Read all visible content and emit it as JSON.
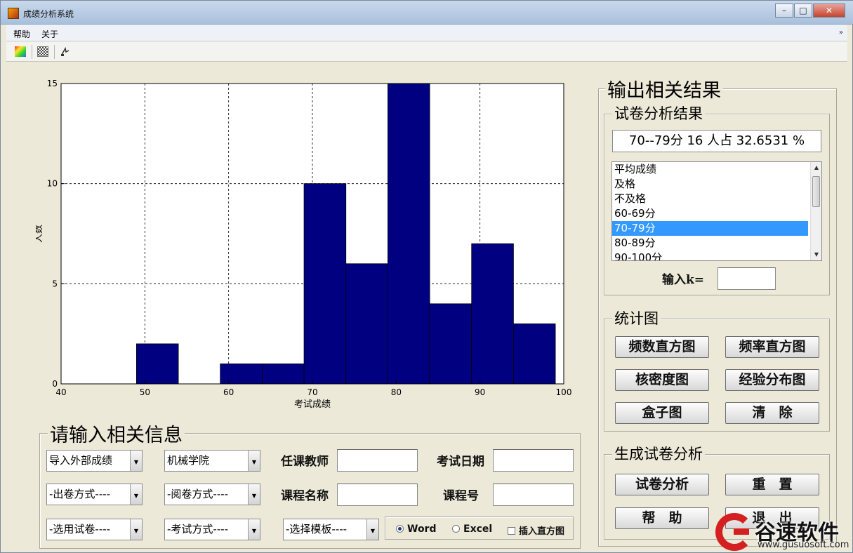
{
  "window": {
    "title": "成绩分析系统",
    "controls": {
      "minimize": "–",
      "maximize": "□",
      "close": "✕"
    }
  },
  "menu": {
    "items": [
      "帮助",
      "关于"
    ],
    "overflow": "»"
  },
  "toolbar": {
    "icons": [
      "colormap-icon",
      "grid-pattern-icon",
      "data-cursor-icon"
    ]
  },
  "chart_data": {
    "type": "bar",
    "title": "",
    "xlabel": "考试成绩",
    "ylabel": "人数",
    "xlim": [
      40,
      100
    ],
    "ylim": [
      0,
      15
    ],
    "xticks": [
      40,
      50,
      60,
      70,
      80,
      90,
      100
    ],
    "yticks": [
      0,
      5,
      10,
      15
    ],
    "grid": true,
    "bar_color": "#000080",
    "bins": [
      {
        "x0": 49,
        "x1": 54,
        "value": 2
      },
      {
        "x0": 54,
        "x1": 59,
        "value": 0
      },
      {
        "x0": 59,
        "x1": 64,
        "value": 1
      },
      {
        "x0": 64,
        "x1": 69,
        "value": 1
      },
      {
        "x0": 69,
        "x1": 74,
        "value": 10
      },
      {
        "x0": 74,
        "x1": 79,
        "value": 6
      },
      {
        "x0": 79,
        "x1": 84,
        "value": 15
      },
      {
        "x0": 84,
        "x1": 89,
        "value": 4
      },
      {
        "x0": 89,
        "x1": 94,
        "value": 7
      },
      {
        "x0": 94,
        "x1": 99,
        "value": 3
      }
    ]
  },
  "output_panel": {
    "title": "输出相关结果",
    "analysis": {
      "title": "试卷分析结果",
      "result_text": "70--79分 16 人占 32.6531 %",
      "list": [
        "平均成绩",
        "及格",
        "不及格",
        "60-69分",
        "70-79分",
        "80-89分",
        "90-100分"
      ],
      "selected_index": 4,
      "k_label": "输入k=",
      "k_value": ""
    },
    "stats": {
      "title": "统计图",
      "buttons": [
        "频数直方图",
        "频率直方图",
        "核密度图",
        "经验分布图",
        "盒子图",
        "清　除"
      ]
    },
    "generate": {
      "title": "生成试卷分析",
      "buttons": [
        "试卷分析",
        "重　置",
        "帮　助",
        "退　出"
      ]
    }
  },
  "input_panel": {
    "title": "请输入相关信息",
    "combos": [
      "导入外部成绩",
      "机械学院",
      "-出卷方式----",
      "-阅卷方式----",
      "-选用试卷----",
      "-考试方式----",
      "-选择模板----"
    ],
    "fields": {
      "teacher": {
        "label": "任课教师",
        "value": ""
      },
      "exam_date": {
        "label": "考试日期",
        "value": ""
      },
      "course_name": {
        "label": "课程名称",
        "value": ""
      },
      "course_no": {
        "label": "课程号",
        "value": ""
      }
    },
    "format_options": {
      "word": "Word",
      "excel": "Excel",
      "selected": "Word",
      "insert_hist": "插入直方图"
    }
  },
  "watermark": {
    "brand": "谷速软件",
    "url": "www.gusuosoft.com"
  }
}
